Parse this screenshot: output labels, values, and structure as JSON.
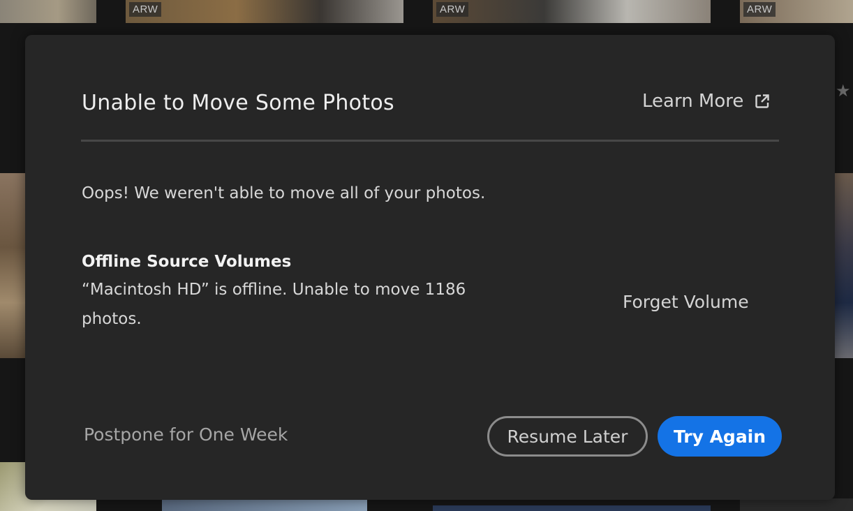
{
  "background": {
    "badges": [
      "ARW",
      "ARW",
      "ARW"
    ],
    "star_icon": "star-icon"
  },
  "dialog": {
    "title": "Unable to Move Some Photos",
    "learn_more_label": "Learn More",
    "learn_more_icon": "external-link-icon",
    "message": "Oops! We weren't able to move all of your photos.",
    "volume_heading": "Offline Source Volumes",
    "volume_description": "“Macintosh HD” is offline. Unable to move 1186 photos.",
    "forget_volume_label": "Forget Volume",
    "postpone_label": "Postpone for One Week",
    "resume_later_label": "Resume Later",
    "try_again_label": "Try Again"
  },
  "colors": {
    "dialog_bg": "#262626",
    "accent": "#1473e6"
  }
}
